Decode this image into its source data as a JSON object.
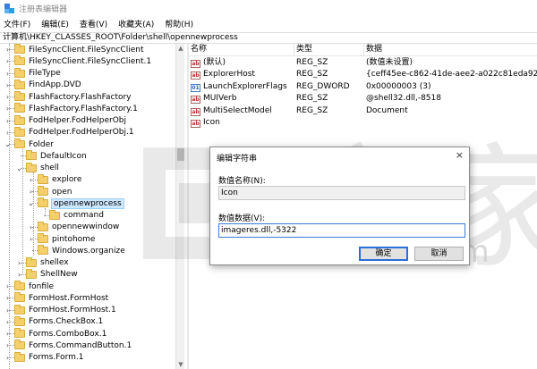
{
  "window": {
    "title": "注册表编辑器"
  },
  "menu": [
    "文件(F)",
    "编辑(E)",
    "查看(V)",
    "收藏夹(A)",
    "帮助(H)"
  ],
  "address": "计算机\\HKEY_CLASSES_ROOT\\Folder\\shell\\opennewprocess",
  "tree": [
    {
      "label": "FileSyncClient.FileSyncClient",
      "chevron": "right"
    },
    {
      "label": "FileSyncClient.FileSyncClient.1",
      "chevron": "right"
    },
    {
      "label": "FileType",
      "chevron": "right"
    },
    {
      "label": "FindApp.DVD",
      "chevron": "right"
    },
    {
      "label": "FlashFactory.FlashFactory",
      "chevron": "right"
    },
    {
      "label": "FlashFactory.FlashFactory.1",
      "chevron": "right"
    },
    {
      "label": "FodHelper.FodHelperObj",
      "chevron": "right"
    },
    {
      "label": "FodHelper.FodHelperObj.1",
      "chevron": "right"
    },
    {
      "label": "Folder",
      "chevron": "down"
    },
    {
      "label": "DefaultIcon",
      "chevron": ""
    },
    {
      "label": "shell",
      "chevron": "down"
    },
    {
      "label": "explore",
      "chevron": "right"
    },
    {
      "label": "open",
      "chevron": "right"
    },
    {
      "label": "opennewprocess",
      "chevron": "down",
      "selected": true
    },
    {
      "label": "command",
      "chevron": ""
    },
    {
      "label": "opennewwindow",
      "chevron": "right"
    },
    {
      "label": "pintohome",
      "chevron": "right"
    },
    {
      "label": "Windows.organize",
      "chevron": ""
    },
    {
      "label": "shellex",
      "chevron": "right"
    },
    {
      "label": "ShellNew",
      "chevron": "right"
    },
    {
      "label": "fonfile",
      "chevron": "right"
    },
    {
      "label": "FormHost.FormHost",
      "chevron": "right"
    },
    {
      "label": "FormHost.FormHost.1",
      "chevron": "right"
    },
    {
      "label": "Forms.CheckBox.1",
      "chevron": "right"
    },
    {
      "label": "Forms.ComboBox.1",
      "chevron": "right"
    },
    {
      "label": "Forms.CommandButton.1",
      "chevron": "right"
    },
    {
      "label": "Forms.Form.1",
      "chevron": "right"
    }
  ],
  "list": {
    "headers": {
      "name": "名称",
      "type": "类型",
      "data": "数据"
    },
    "rows": [
      {
        "name": "(默认)",
        "type": "REG_SZ",
        "data": "(数值未设置)",
        "icon": "string-value-icon"
      },
      {
        "name": "ExplorerHost",
        "type": "REG_SZ",
        "data": "{ceff45ee-c862-41de-aee2-a022c81eda92}",
        "icon": "string-value-icon"
      },
      {
        "name": "LaunchExplorerFlags",
        "type": "REG_DWORD",
        "data": "0x00000003 (3)",
        "icon": "binary-value-icon"
      },
      {
        "name": "MUIVerb",
        "type": "REG_SZ",
        "data": "@shell32.dll,-8518",
        "icon": "string-value-icon"
      },
      {
        "name": "MultiSelectModel",
        "type": "REG_SZ",
        "data": "Document",
        "icon": "string-value-icon"
      },
      {
        "name": "Icon",
        "type": "",
        "data": "",
        "icon": "string-value-icon"
      }
    ]
  },
  "dialog": {
    "title": "编辑字符串",
    "close": "×",
    "name_label": "数值名称(N):",
    "name_value": "Icon",
    "data_label": "数值数据(V):",
    "data_value": "imageres.dll,-5322",
    "ok": "确定",
    "cancel": "取消"
  },
  "watermark": {
    "text": "www.ithome.com"
  }
}
